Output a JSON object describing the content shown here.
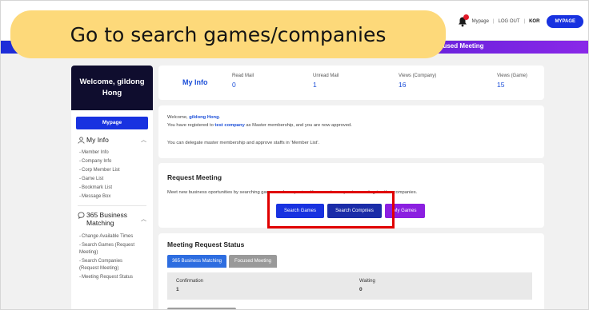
{
  "callout": {
    "text": "Go to search games/companies"
  },
  "header": {
    "links": [
      "Mypage",
      "LOG OUT",
      "KOR"
    ],
    "separator": "|",
    "mypage_button": "MYPAGE",
    "subbar_focused": "cused Meeting"
  },
  "sidebar": {
    "welcome": "Welcome, gildong Hong",
    "mypage": "Mypage",
    "my_info": {
      "label": "My Info",
      "items": [
        "Member Info",
        "Company Info",
        "Corp Member List",
        "Game List",
        "Bookmark List",
        "Message Box"
      ]
    },
    "business": {
      "label": "365 Business Matching",
      "items": [
        "Change Available Times",
        "Search Games (Request Meeting)",
        "Search Companies (Request Meeting)",
        "Meeting Request Status"
      ]
    }
  },
  "info": {
    "title": "My Info",
    "stats": [
      {
        "label": "Read Mail",
        "value": "0"
      },
      {
        "label": "Unread Mail",
        "value": "1"
      },
      {
        "label": "Views (Company)",
        "value": "16"
      },
      {
        "label": "Views (Game)",
        "value": "15"
      }
    ]
  },
  "message": {
    "line1_prefix": "Welcome, ",
    "user": "gildong Hong",
    "line1_suffix": ".",
    "line2_prefix": "You have registered to ",
    "company": "test company",
    "line2_suffix": " as Master membership, and you are now approved.",
    "line3": "You can delegate master membership and approve staffs in 'Member List'."
  },
  "request": {
    "title": "Request Meeting",
    "description": "Meet new business oportunities by searching games and companies. You can also request a meeting to other companies.",
    "buttons": [
      "Search Games",
      "Search Compnies",
      "My Games"
    ]
  },
  "status": {
    "title": "Meeting Request Status",
    "tabs": [
      "365 Business Matching",
      "Focused Meeting"
    ],
    "confirmation_label": "Confirmation",
    "confirmation_value": "1",
    "waiting_label": "Waiting",
    "waiting_value": "0"
  },
  "colors": {
    "primary": "#1832e0",
    "accent_purple": "#8b1fe0",
    "highlight_red": "#e00000",
    "callout_yellow": "#fdd97a",
    "welcome_dark": "#0f0d2e"
  }
}
